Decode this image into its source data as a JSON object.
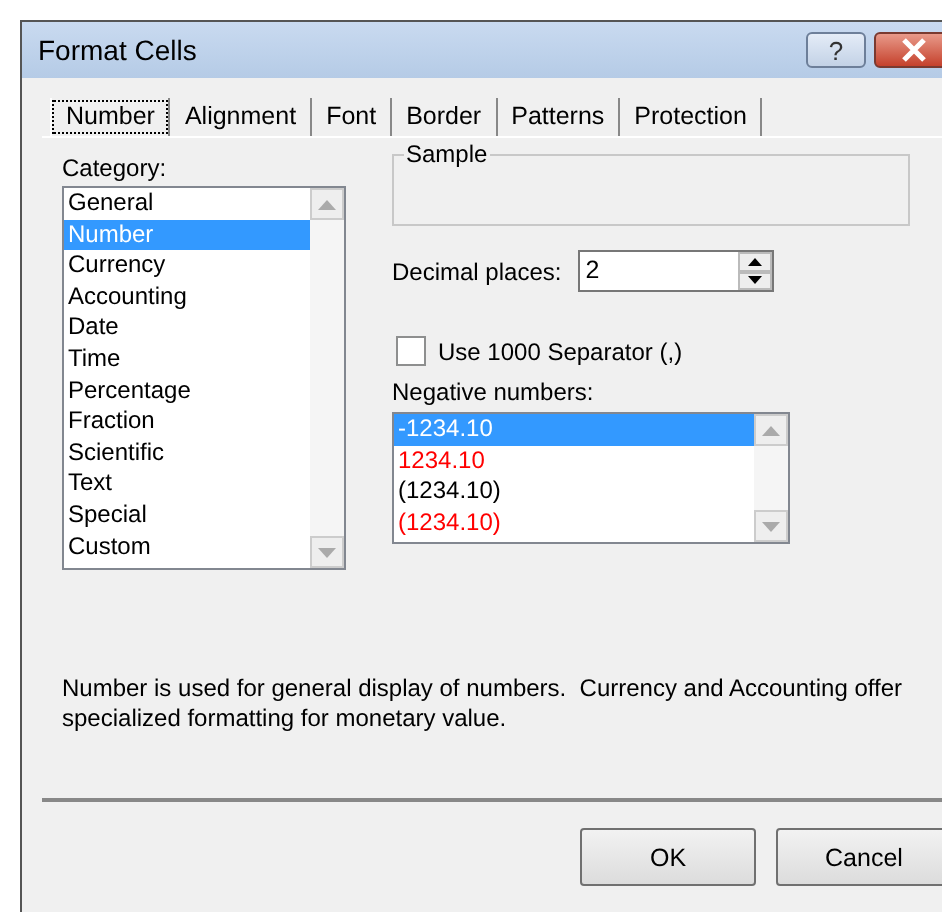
{
  "window": {
    "title": "Format Cells",
    "help_button": "?"
  },
  "tabs": [
    {
      "label": "Number",
      "selected": true
    },
    {
      "label": "Alignment",
      "selected": false
    },
    {
      "label": "Font",
      "selected": false
    },
    {
      "label": "Border",
      "selected": false
    },
    {
      "label": "Patterns",
      "selected": false
    },
    {
      "label": "Protection",
      "selected": false
    }
  ],
  "category": {
    "label": "Category:",
    "items": [
      {
        "label": "General",
        "selected": false
      },
      {
        "label": "Number",
        "selected": true
      },
      {
        "label": "Currency",
        "selected": false
      },
      {
        "label": "Accounting",
        "selected": false
      },
      {
        "label": "Date",
        "selected": false
      },
      {
        "label": "Time",
        "selected": false
      },
      {
        "label": "Percentage",
        "selected": false
      },
      {
        "label": "Fraction",
        "selected": false
      },
      {
        "label": "Scientific",
        "selected": false
      },
      {
        "label": "Text",
        "selected": false
      },
      {
        "label": "Special",
        "selected": false
      },
      {
        "label": "Custom",
        "selected": false
      }
    ]
  },
  "sample": {
    "label": "Sample"
  },
  "decimal_places": {
    "label": "Decimal places:",
    "value": "2"
  },
  "separator": {
    "label": "Use 1000 Separator (,)",
    "checked": false
  },
  "negative_numbers": {
    "label": "Negative numbers:",
    "items": [
      {
        "label": "-1234.10",
        "selected": true
      },
      {
        "label": "1234.10",
        "selected": false,
        "color": "#ff0000"
      },
      {
        "label": "(1234.10)",
        "selected": false,
        "color": "#000000"
      },
      {
        "label": "(1234.10)",
        "selected": false,
        "color": "#ff0000"
      }
    ]
  },
  "description": "Number is used for general display of numbers.  Currency and Accounting offer specialized formatting for monetary value.",
  "buttons": [
    "OK",
    "Cancel"
  ]
}
